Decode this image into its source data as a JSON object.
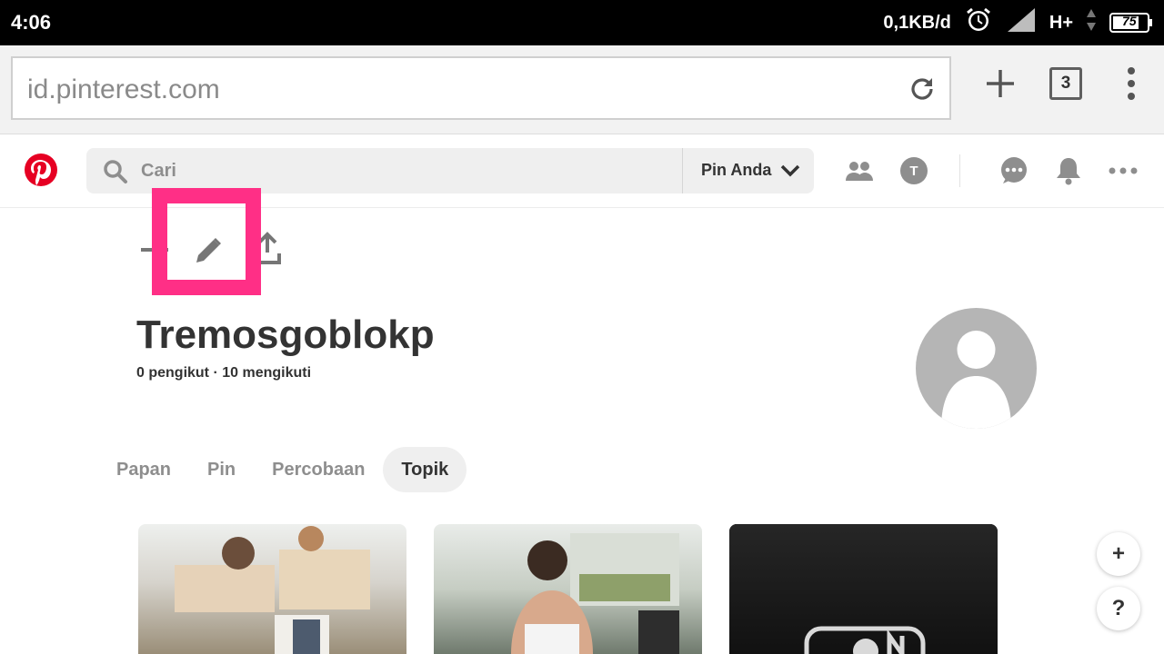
{
  "status": {
    "time": "4:06",
    "speed": "0,1KB/d",
    "network": "H+",
    "battery": "75"
  },
  "browser": {
    "url": "id.pinterest.com",
    "tab_count": "3"
  },
  "header": {
    "search_placeholder": "Cari",
    "your_pins": "Pin Anda",
    "avatar_letter": "T"
  },
  "profile": {
    "name": "Tremosgoblokp",
    "stats": "0 pengikut · 10 mengikuti"
  },
  "tabs": [
    {
      "label": "Papan",
      "active": false
    },
    {
      "label": "Pin",
      "active": false
    },
    {
      "label": "Percobaan",
      "active": false
    },
    {
      "label": "Topik",
      "active": true
    }
  ],
  "floating": {
    "add": "+",
    "help": "?"
  },
  "colors": {
    "pinterest_red": "#e60023",
    "highlight": "#ff2f86",
    "icon_gray": "#8e8e8e"
  },
  "icons": [
    "alarm-icon",
    "signal-icon",
    "battery-icon",
    "reload-icon",
    "plus-icon",
    "overflow-menu-icon",
    "search-icon",
    "chevron-down-icon",
    "people-icon",
    "chat-icon",
    "bell-icon",
    "more-icon",
    "pencil-icon",
    "share-icon"
  ]
}
